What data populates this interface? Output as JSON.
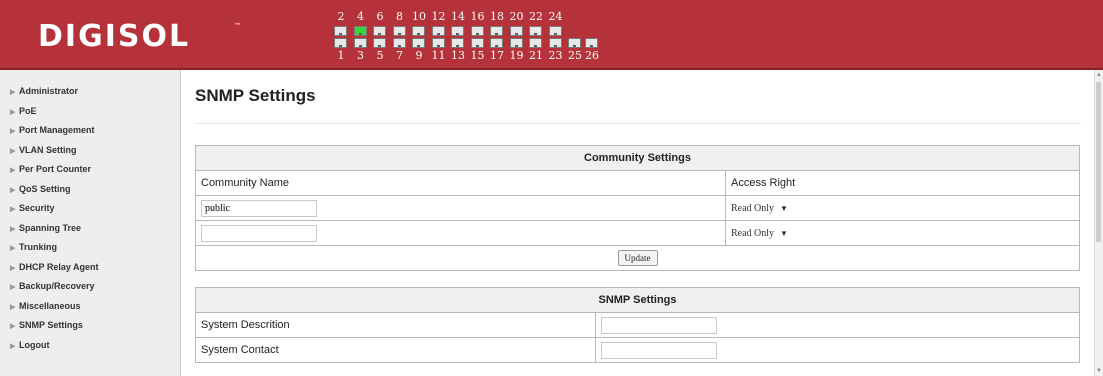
{
  "header": {
    "logo_text": "DIGISOL",
    "logo_tm": "™",
    "top_port_labels": [
      "2",
      "4",
      "6",
      "8",
      "10",
      "12",
      "14",
      "16",
      "18",
      "20",
      "22",
      "24"
    ],
    "bottom_port_labels": [
      "1",
      "3",
      "5",
      "7",
      "9",
      "11",
      "13",
      "15",
      "17",
      "19",
      "21",
      "23"
    ],
    "uplink_port_labels": [
      "25",
      "26"
    ],
    "active_port": "4",
    "colors": {
      "header_bg": "#b5323a",
      "port_active": "#3cd43c"
    }
  },
  "sidebar": {
    "items": [
      {
        "label": "Administrator"
      },
      {
        "label": "PoE"
      },
      {
        "label": "Port Management"
      },
      {
        "label": "VLAN Setting"
      },
      {
        "label": "Per Port Counter"
      },
      {
        "label": "QoS Setting"
      },
      {
        "label": "Security"
      },
      {
        "label": "Spanning Tree"
      },
      {
        "label": "Trunking"
      },
      {
        "label": "DHCP Relay Agent"
      },
      {
        "label": "Backup/Recovery"
      },
      {
        "label": "Miscellaneous"
      },
      {
        "label": "SNMP Settings"
      },
      {
        "label": "Logout"
      }
    ]
  },
  "main": {
    "title": "SNMP Settings",
    "community": {
      "heading": "Community Settings",
      "col_name": "Community Name",
      "col_access": "Access Right",
      "rows": [
        {
          "name": "public",
          "access": "Read Only"
        },
        {
          "name": "",
          "access": "Read Only"
        }
      ],
      "update_label": "Update"
    },
    "snmp": {
      "heading": "SNMP Settings",
      "rows": [
        {
          "label": "System Descrition",
          "value": ""
        },
        {
          "label": "System Contact",
          "value": ""
        }
      ]
    }
  }
}
